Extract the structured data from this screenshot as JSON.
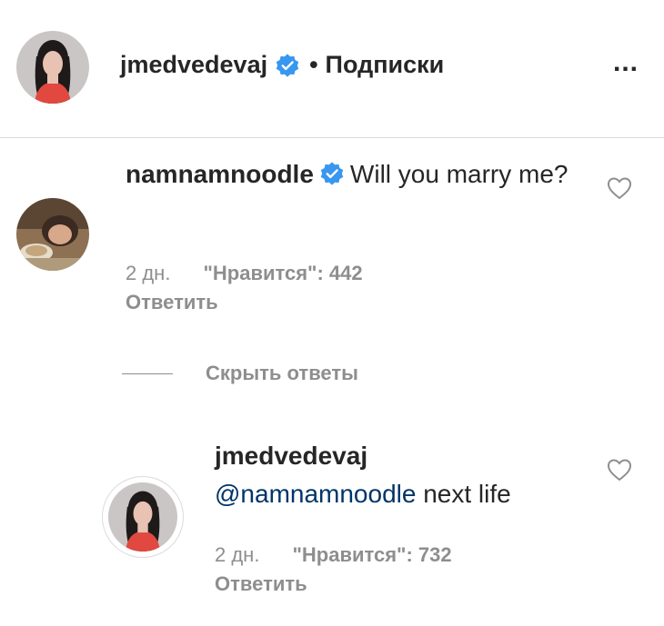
{
  "header": {
    "username": "jmedvedevaj",
    "separator": "•",
    "follow_label": "Подписки",
    "more_label": "..."
  },
  "comment": {
    "username": "namnamnoodle",
    "text": "Will you marry me?",
    "time": "2 дн.",
    "likes": "\"Нравится\": 442",
    "reply_label": "Ответить"
  },
  "hide_replies_label": "Скрыть ответы",
  "reply": {
    "username": "jmedvedevaj",
    "mention": "@namnamnoodle",
    "text": " next life",
    "time": "2 дн.",
    "likes": "\"Нравится\": 732",
    "reply_label": "Ответить"
  },
  "colors": {
    "verified": "#3897f0",
    "muted": "#8e8e8e",
    "mention": "#003569",
    "divider": "#dbdbdb"
  },
  "icons": {
    "verified": "verified-badge-icon",
    "heart": "heart-outline-icon",
    "more": "more-options-icon"
  }
}
